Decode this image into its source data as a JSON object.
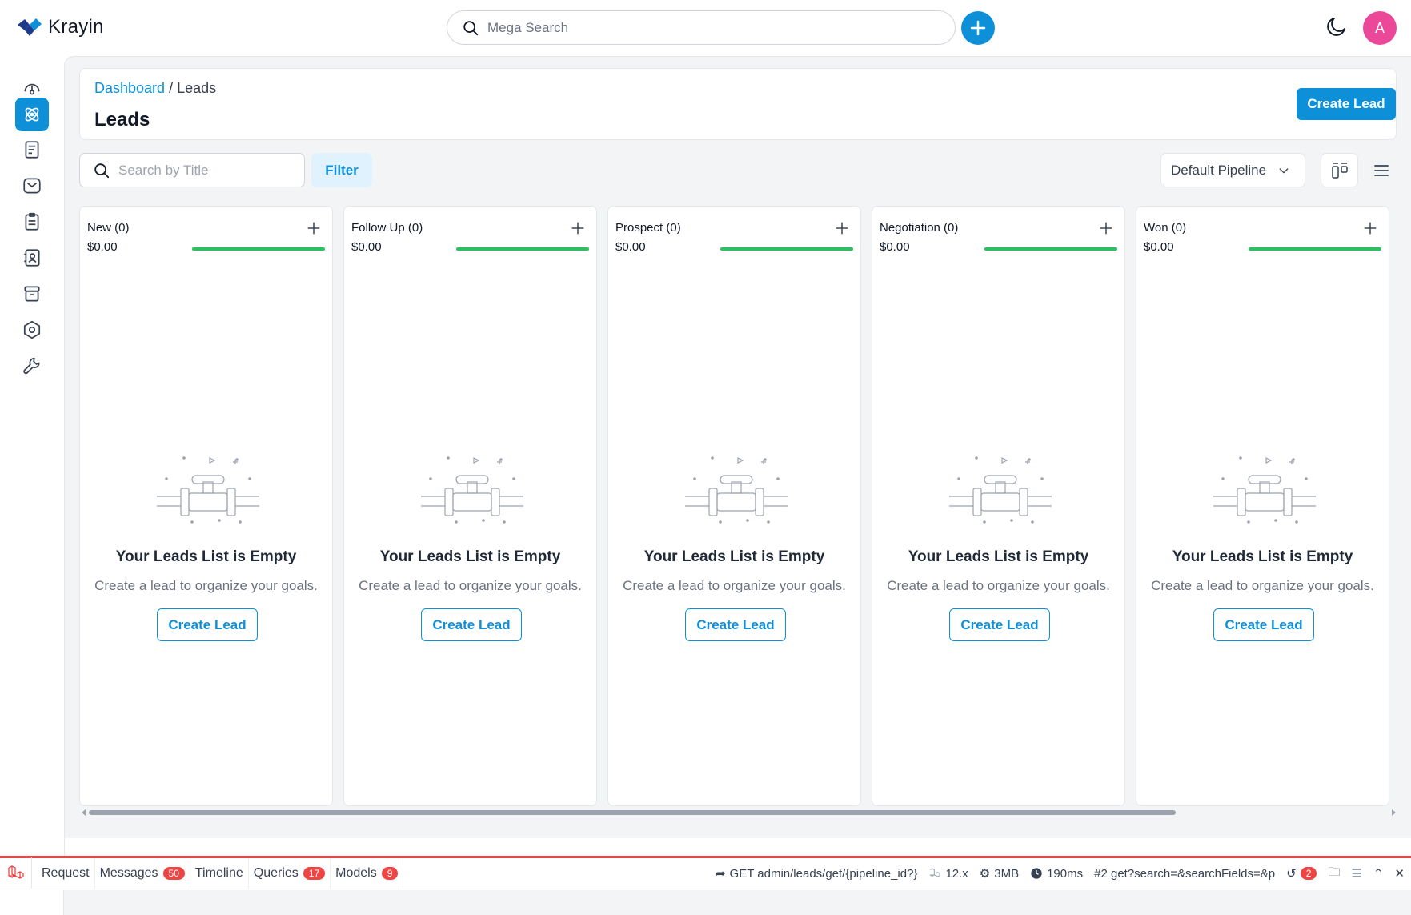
{
  "app": {
    "name": "Krayin"
  },
  "topbar": {
    "search_placeholder": "Mega Search",
    "avatar_initial": "A"
  },
  "sidebar": {
    "items": [
      {
        "icon": "dashboard-icon",
        "active": false
      },
      {
        "icon": "leads-icon",
        "active": true
      },
      {
        "icon": "quotes-icon",
        "active": false
      },
      {
        "icon": "mail-icon",
        "active": false
      },
      {
        "icon": "activities-icon",
        "active": false
      },
      {
        "icon": "contacts-icon",
        "active": false
      },
      {
        "icon": "products-icon",
        "active": false
      },
      {
        "icon": "settings-icon",
        "active": false
      },
      {
        "icon": "configuration-icon",
        "active": false
      }
    ]
  },
  "header": {
    "breadcrumb_link": "Dashboard",
    "breadcrumb_sep": "/",
    "breadcrumb_current": "Leads",
    "title": "Leads",
    "create_button": "Create Lead"
  },
  "toolbar": {
    "search_placeholder": "Search by Title",
    "filter_label": "Filter",
    "pipeline_value": "Default Pipeline"
  },
  "columns": [
    {
      "name": "New (0)",
      "amount": "$0.00"
    },
    {
      "name": "Follow Up (0)",
      "amount": "$0.00"
    },
    {
      "name": "Prospect (0)",
      "amount": "$0.00"
    },
    {
      "name": "Negotiation (0)",
      "amount": "$0.00"
    },
    {
      "name": "Won (0)",
      "amount": "$0.00"
    }
  ],
  "empty_state": {
    "title": "Your Leads List is Empty",
    "subtitle": "Create a lead to organize your goals.",
    "button": "Create Lead"
  },
  "debugbar": {
    "tabs": [
      {
        "label": "Request",
        "count": ""
      },
      {
        "label": "Messages",
        "count": "50"
      },
      {
        "label": "Timeline",
        "count": ""
      },
      {
        "label": "Queries",
        "count": "17"
      },
      {
        "label": "Models",
        "count": "9"
      }
    ],
    "route": "GET admin/leads/get/{pipeline_id?}",
    "version": "12.x",
    "memory": "3MB",
    "time": "190ms",
    "request": "#2 get?search=&searchFields=&p",
    "history_count": "2"
  },
  "colors": {
    "primary": "#0e90d9",
    "progress": "#22c55e",
    "avatar": "#ec4899",
    "debug_accent": "#ef4444"
  }
}
